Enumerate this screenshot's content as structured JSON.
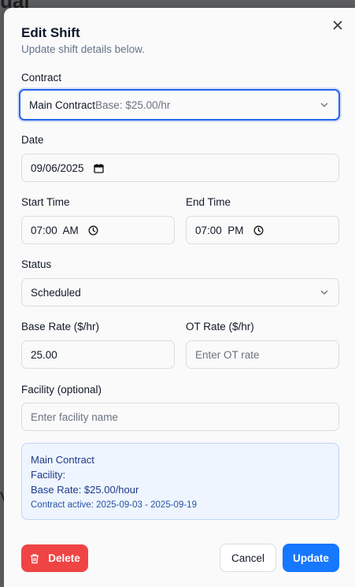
{
  "backdrop": {
    "partial_text": "ual",
    "partial_char": "V"
  },
  "modal": {
    "title": "Edit Shift",
    "subtitle": "Update shift details below."
  },
  "contract": {
    "label": "Contract",
    "selected_name": "Main Contract",
    "selected_detail": "Base: $25.00/hr"
  },
  "date": {
    "label": "Date",
    "value": "09/06/2025"
  },
  "start_time": {
    "label": "Start Time",
    "value": "07:00  AM"
  },
  "end_time": {
    "label": "End Time",
    "value": "07:00  PM"
  },
  "status": {
    "label": "Status",
    "value": "Scheduled"
  },
  "base_rate": {
    "label": "Base Rate ($/hr)",
    "value": "25.00"
  },
  "ot_rate": {
    "label": "OT Rate ($/hr)",
    "placeholder": "Enter OT rate"
  },
  "facility": {
    "label": "Facility (optional)",
    "placeholder": "Enter facility name"
  },
  "info": {
    "contract_name": "Main Contract",
    "facility_line": "Facility:",
    "base_rate_line": "Base Rate: $25.00/hour",
    "active_line": "Contract active: 2025-09-03 - 2025-09-19"
  },
  "buttons": {
    "delete": "Delete",
    "cancel": "Cancel",
    "update": "Update"
  },
  "colors": {
    "accent": "#1677ff",
    "danger": "#ef4444",
    "focus_ring": "#2563eb",
    "info_bg": "#eef5ff"
  },
  "icons": {
    "close": "close-icon",
    "chevron": "chevron-down-icon",
    "calendar": "calendar-icon",
    "clock": "clock-icon",
    "trash": "trash-icon"
  }
}
